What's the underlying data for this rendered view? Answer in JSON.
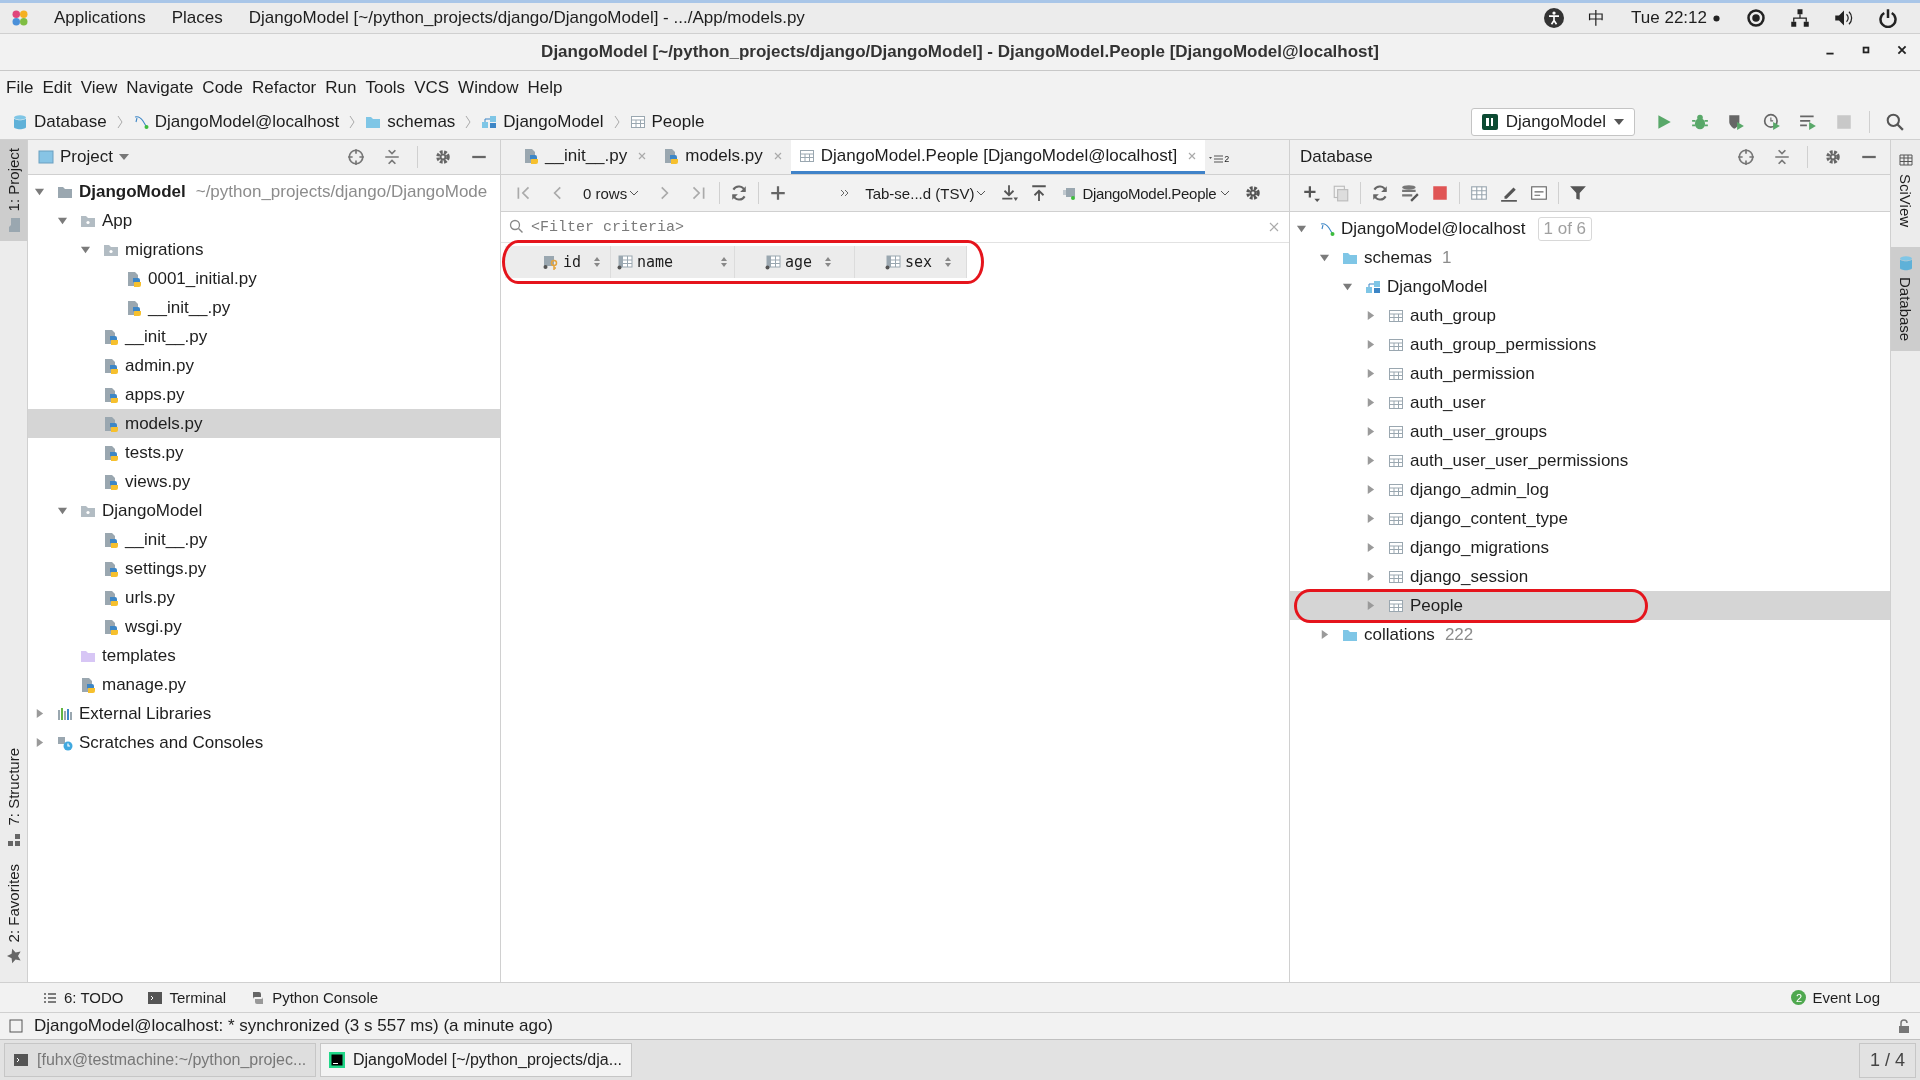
{
  "top_bar": {
    "applications": "Applications",
    "places": "Places",
    "window": "DjangoModel [~/python_projects/django/DjangoModel] - .../App/models.py",
    "input_method": "中",
    "clock": "Tue 22:12"
  },
  "window": {
    "title": "DjangoModel [~/python_projects/django/DjangoModel] - DjangoModel.People [DjangoModel@localhost]"
  },
  "menu": [
    "File",
    "Edit",
    "View",
    "Navigate",
    "Code",
    "Refactor",
    "Run",
    "Tools",
    "VCS",
    "Window",
    "Help"
  ],
  "breadcrumbs": [
    {
      "label": "Database",
      "kind": "database"
    },
    {
      "label": "DjangoModel@localhost",
      "kind": "connection"
    },
    {
      "label": "schemas",
      "kind": "folder"
    },
    {
      "label": "DjangoModel",
      "kind": "schema"
    },
    {
      "label": "People",
      "kind": "table"
    }
  ],
  "run_config": "DjangoModel",
  "left_strip": [
    {
      "label": "1: Project",
      "kind": "project",
      "selected": true
    },
    {
      "label": "7: Structure",
      "kind": "structure",
      "selected": false
    },
    {
      "label": "2: Favorites",
      "kind": "favorites",
      "selected": false
    }
  ],
  "right_strip": [
    {
      "label": "SciView",
      "kind": "sciview",
      "selected": false
    },
    {
      "label": "Database",
      "kind": "database",
      "selected": true
    }
  ],
  "project_panel": {
    "title": "Project",
    "tree": [
      {
        "label": "DjangoModel",
        "hint": "~/python_projects/django/DjangoMode",
        "kind": "project",
        "expanded": true,
        "selected": false,
        "children": [
          {
            "label": "App",
            "kind": "package",
            "expanded": true,
            "selected": false,
            "children": [
              {
                "label": "migrations",
                "kind": "package",
                "expanded": true,
                "selected": false,
                "children": [
                  {
                    "label": "0001_initial.py",
                    "kind": "python",
                    "selected": false
                  },
                  {
                    "label": "__init__.py",
                    "kind": "python",
                    "selected": false
                  }
                ]
              },
              {
                "label": "__init__.py",
                "kind": "python",
                "selected": false
              },
              {
                "label": "admin.py",
                "kind": "python",
                "selected": false
              },
              {
                "label": "apps.py",
                "kind": "python",
                "selected": false
              },
              {
                "label": "models.py",
                "kind": "python",
                "selected": true
              },
              {
                "label": "tests.py",
                "kind": "python",
                "selected": false
              },
              {
                "label": "views.py",
                "kind": "python",
                "selected": false
              }
            ]
          },
          {
            "label": "DjangoModel",
            "kind": "package",
            "expanded": true,
            "selected": false,
            "children": [
              {
                "label": "__init__.py",
                "kind": "python",
                "selected": false
              },
              {
                "label": "settings.py",
                "kind": "python",
                "selected": false
              },
              {
                "label": "urls.py",
                "kind": "python",
                "selected": false
              },
              {
                "label": "wsgi.py",
                "kind": "python",
                "selected": false
              }
            ]
          },
          {
            "label": "templates",
            "kind": "templates",
            "selected": false
          },
          {
            "label": "manage.py",
            "kind": "python",
            "selected": false
          }
        ]
      },
      {
        "label": "External Libraries",
        "kind": "libraries",
        "expanded": false,
        "selected": false
      },
      {
        "label": "Scratches and Consoles",
        "kind": "scratches",
        "expanded": false,
        "selected": false
      }
    ]
  },
  "editor": {
    "tabs": [
      {
        "label": "__init__.py",
        "kind": "python",
        "selected": false
      },
      {
        "label": "models.py",
        "kind": "python",
        "selected": false
      },
      {
        "label": "DjangoModel.People [DjangoModel@localhost]",
        "kind": "table",
        "selected": true
      }
    ],
    "hidden_tabs": "2",
    "rows": "0 rows",
    "format": "Tab-se...d (TSV)",
    "target": "DjangoModel.People",
    "filter_placeholder": "<Filter criteria>",
    "columns_highlighted": true,
    "columns": [
      {
        "name": "id",
        "kind": "key"
      },
      {
        "name": "name",
        "kind": "column"
      },
      {
        "name": "age",
        "kind": "column"
      },
      {
        "name": "sex",
        "kind": "column"
      }
    ]
  },
  "database_panel": {
    "title": "Database",
    "tree": [
      {
        "label": "DjangoModel@localhost",
        "kind": "connection",
        "badge": "1 of 6",
        "expanded": true,
        "selected": false,
        "children": [
          {
            "label": "schemas",
            "kind": "folder",
            "count": "1",
            "expanded": true,
            "selected": false,
            "children": [
              {
                "label": "DjangoModel",
                "kind": "schema",
                "expanded": true,
                "selected": false,
                "children": [
                  {
                    "label": "auth_group",
                    "kind": "table",
                    "expanded": false,
                    "selected": false
                  },
                  {
                    "label": "auth_group_permissions",
                    "kind": "table",
                    "expanded": false,
                    "selected": false
                  },
                  {
                    "label": "auth_permission",
                    "kind": "table",
                    "expanded": false,
                    "selected": false
                  },
                  {
                    "label": "auth_user",
                    "kind": "table",
                    "expanded": false,
                    "selected": false
                  },
                  {
                    "label": "auth_user_groups",
                    "kind": "table",
                    "expanded": false,
                    "selected": false
                  },
                  {
                    "label": "auth_user_user_permissions",
                    "kind": "table",
                    "expanded": false,
                    "selected": false
                  },
                  {
                    "label": "django_admin_log",
                    "kind": "table",
                    "expanded": false,
                    "selected": false
                  },
                  {
                    "label": "django_content_type",
                    "kind": "table",
                    "expanded": false,
                    "selected": false
                  },
                  {
                    "label": "django_migrations",
                    "kind": "table",
                    "expanded": false,
                    "selected": false
                  },
                  {
                    "label": "django_session",
                    "kind": "table",
                    "expanded": false,
                    "selected": false
                  },
                  {
                    "label": "People",
                    "kind": "table",
                    "expanded": false,
                    "selected": true,
                    "highlighted": true
                  }
                ]
              }
            ]
          },
          {
            "label": "collations",
            "kind": "folder",
            "count": "222",
            "expanded": false,
            "selected": false
          }
        ]
      }
    ]
  },
  "tool_windows": [
    {
      "label": "6: TODO",
      "kind": "todo"
    },
    {
      "label": "Terminal",
      "kind": "terminal"
    },
    {
      "label": "Python Console",
      "kind": "console"
    }
  ],
  "event_log": {
    "label": "Event Log",
    "count": "2"
  },
  "status": "DjangoModel@localhost: * synchronized (3 s 557 ms) (a minute ago)",
  "taskbar": {
    "items": [
      {
        "label": "[fuhx@testmachine:~/python_projec...",
        "kind": "terminal",
        "selected": false
      },
      {
        "label": "DjangoModel [~/python_projects/dja...",
        "kind": "pycharm",
        "selected": true
      }
    ],
    "workspace": "1 / 4"
  }
}
